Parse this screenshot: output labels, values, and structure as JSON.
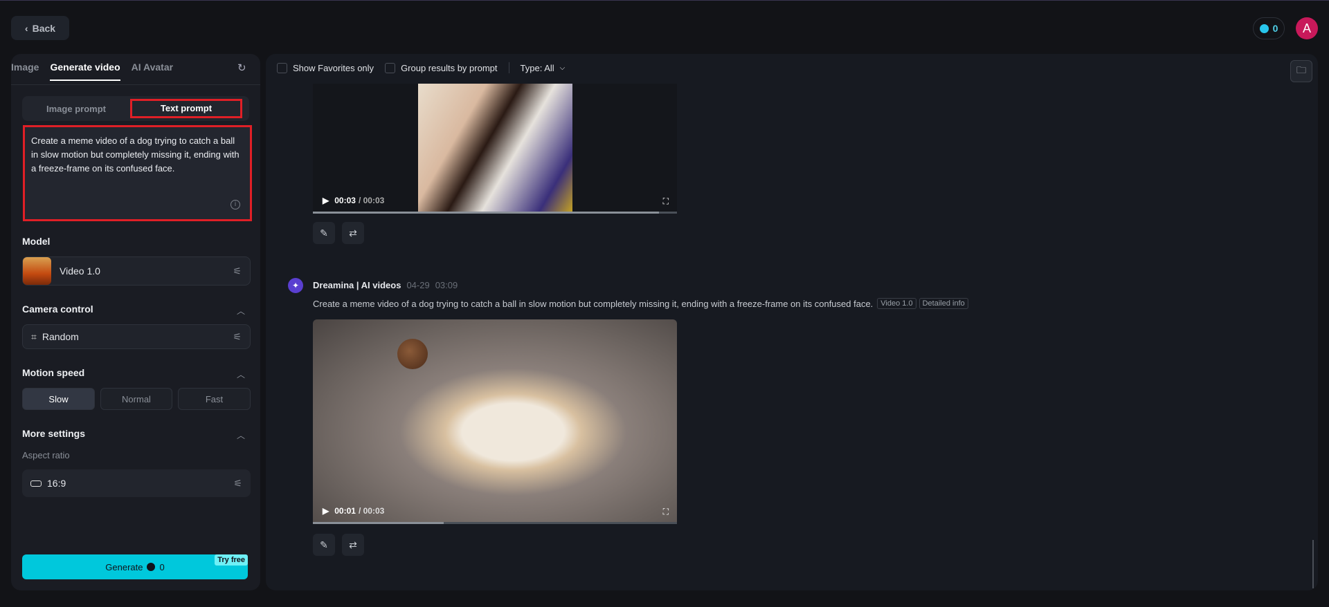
{
  "header": {
    "back_label": "Back",
    "credits": "0",
    "avatar_letter": "A"
  },
  "sidebar": {
    "tabs": [
      "Image",
      "Generate video",
      "AI Avatar"
    ],
    "prompt_toggle": {
      "image": "Image prompt",
      "text": "Text prompt"
    },
    "prompt_text": "Create a meme video of a dog trying to catch a ball in slow motion but completely missing it, ending with a freeze-frame on its confused face.",
    "model_label": "Model",
    "model_value": "Video 1.0",
    "camera_label": "Camera control",
    "camera_value": "Random",
    "motion_label": "Motion speed",
    "speeds": [
      "Slow",
      "Normal",
      "Fast"
    ],
    "more_label": "More settings",
    "aspect_label": "Aspect ratio",
    "aspect_value": "16:9",
    "generate_label": "Generate",
    "generate_cost": "0",
    "try_free": "Try free"
  },
  "toolbar": {
    "favorites": "Show Favorites only",
    "group": "Group results by prompt",
    "type": "Type: All"
  },
  "results": [
    {
      "time_current": "00:03",
      "time_total": "/ 00:03",
      "progress": 0.95
    },
    {
      "author": "Dreamina | AI videos",
      "date": "04-29",
      "time": "03:09",
      "prompt": "Create a meme video of a dog trying to catch a ball in slow motion but completely missing it, ending with a freeze-frame on its confused face.",
      "model_tag": "Video 1.0",
      "info_tag": "Detailed info",
      "time_current": "00:01",
      "time_total": "/ 00:03",
      "progress": 0.36
    }
  ]
}
